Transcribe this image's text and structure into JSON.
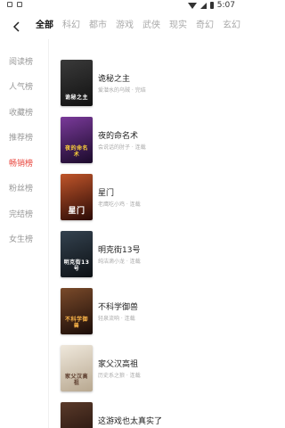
{
  "status_bar": {
    "time": "5:07"
  },
  "nav": {
    "tabs": [
      {
        "label": "全部",
        "active": true
      },
      {
        "label": "科幻",
        "active": false
      },
      {
        "label": "都市",
        "active": false
      },
      {
        "label": "游戏",
        "active": false
      },
      {
        "label": "武侠",
        "active": false
      },
      {
        "label": "现实",
        "active": false
      },
      {
        "label": "奇幻",
        "active": false
      },
      {
        "label": "玄幻",
        "active": false
      }
    ]
  },
  "sidebar": {
    "items": [
      {
        "label": "阅读榜",
        "active": false
      },
      {
        "label": "人气榜",
        "active": false
      },
      {
        "label": "收藏榜",
        "active": false
      },
      {
        "label": "推荐榜",
        "active": false
      },
      {
        "label": "畅销榜",
        "active": true
      },
      {
        "label": "粉丝榜",
        "active": false
      },
      {
        "label": "完结榜",
        "active": false
      },
      {
        "label": "女生榜",
        "active": false
      }
    ]
  },
  "books": [
    {
      "title": "诡秘之主",
      "author": "爱潜水的乌贼",
      "status": "完结",
      "cover_text": "诡秘之主",
      "cover_color": "#2b2b2b"
    },
    {
      "title": "夜的命名术",
      "author": "会说话的肘子",
      "status": "连载",
      "cover_text": "夜的命名术",
      "cover_color": "#5b2a6e"
    },
    {
      "title": "星门",
      "author": "老鹰吃小鸡",
      "status": "连载",
      "cover_text": "星门",
      "cover_color": "#8a2a1a"
    },
    {
      "title": "明克街13号",
      "author": "纯洁滴小龙",
      "status": "连载",
      "cover_text": "明克街13号",
      "cover_color": "#1f2a33"
    },
    {
      "title": "不科学御兽",
      "author": "轻泉流响",
      "status": "连载",
      "cover_text": "不科学御兽",
      "cover_color": "#4a2a20"
    },
    {
      "title": "家父汉高祖",
      "author": "历史系之狼",
      "status": "连载",
      "cover_text": "家父汉高祖",
      "cover_color": "#d8cfc0"
    },
    {
      "title": "这游戏也太真实了",
      "author": "",
      "status": "",
      "cover_text": "",
      "cover_color": "#3a2a22"
    }
  ],
  "colors": {
    "accent": "#e8453c"
  }
}
